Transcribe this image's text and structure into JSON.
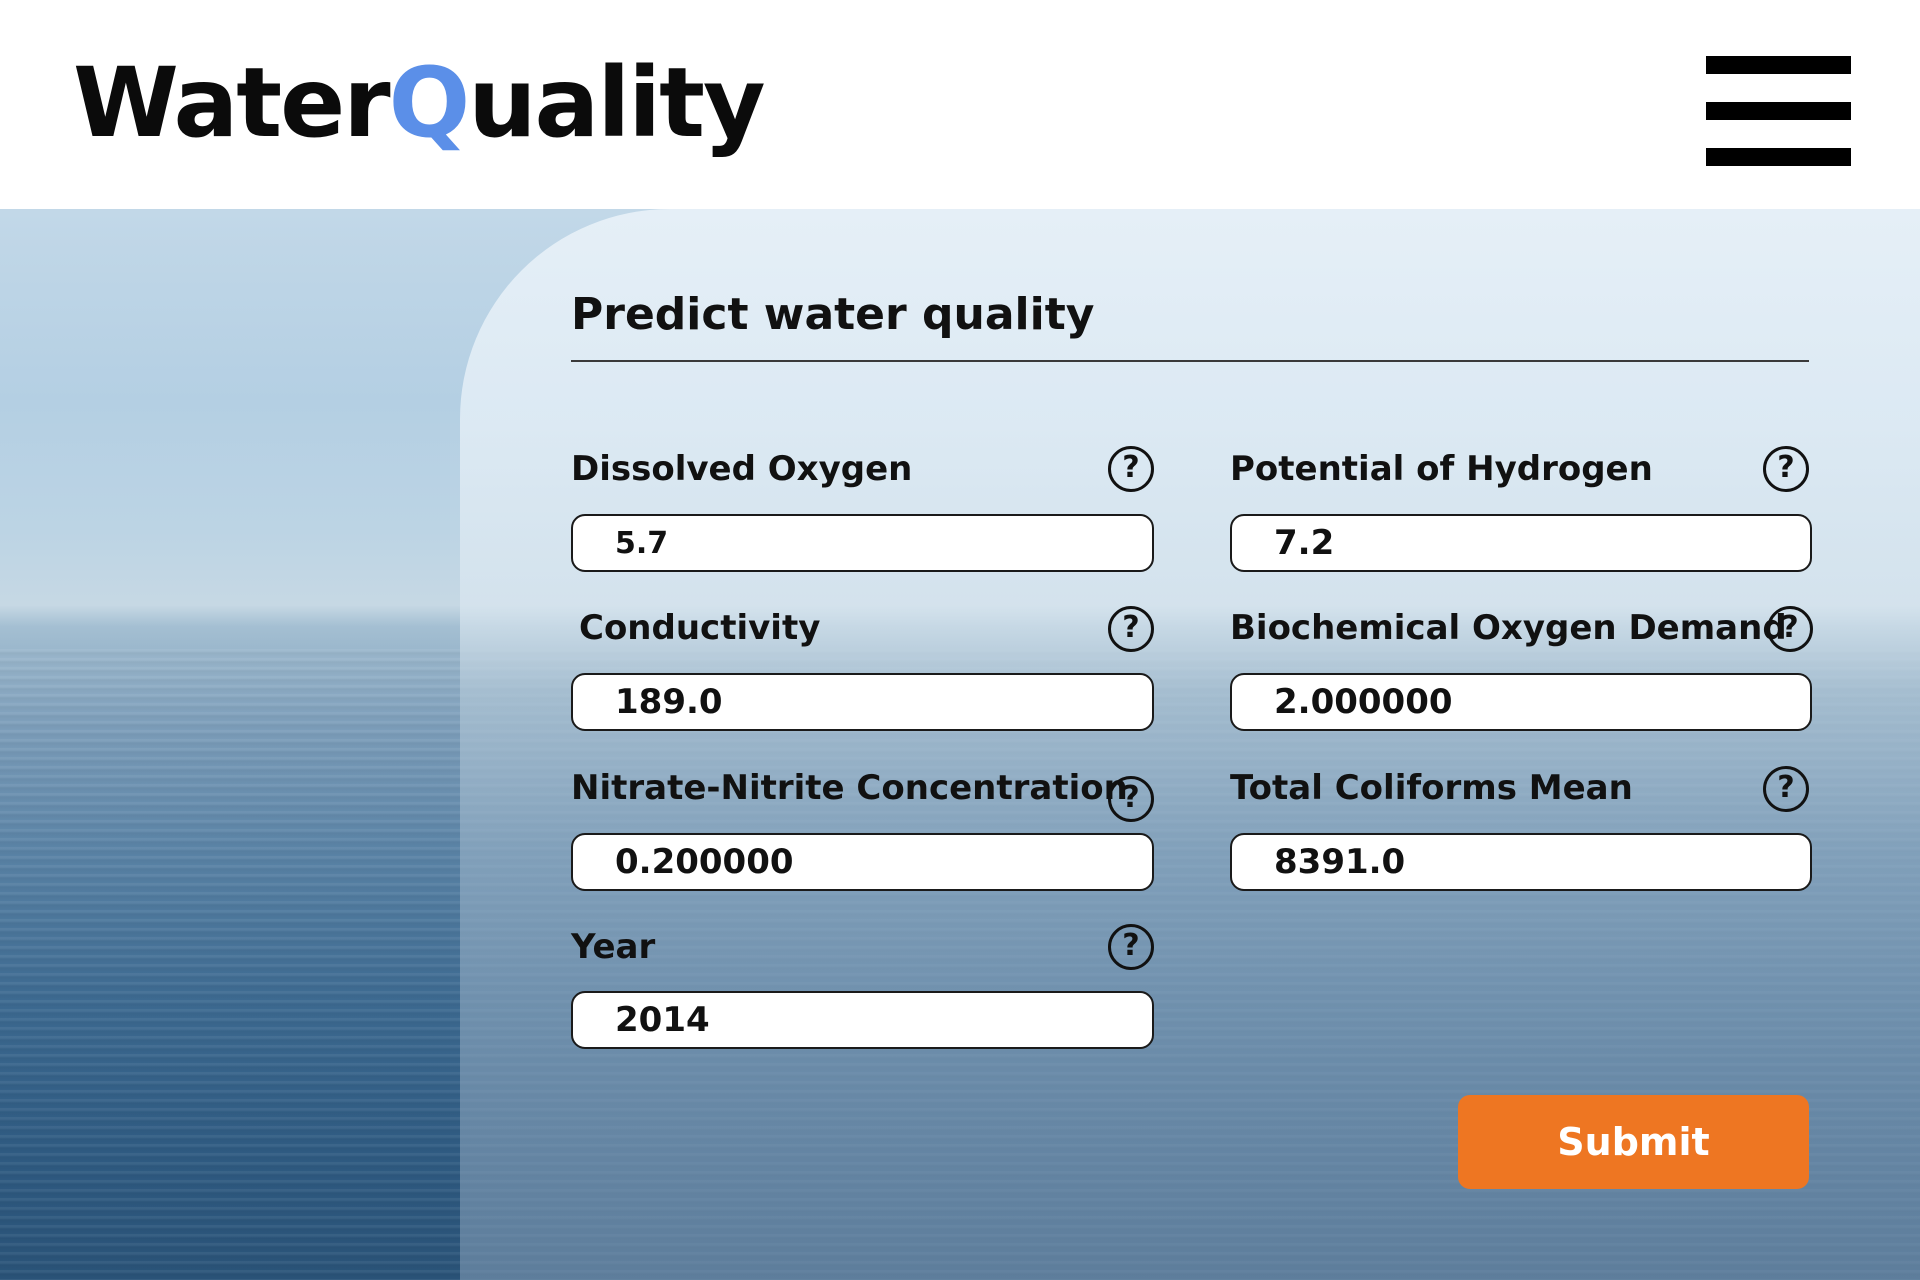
{
  "header": {
    "logo_part1": "Water",
    "logo_part2": "Q",
    "logo_part3": "uality",
    "menu_icon": "hamburger-menu-icon"
  },
  "form": {
    "title": "Predict water quality",
    "fields": {
      "dissolved_oxygen": {
        "label": "Dissolved Oxygen",
        "value": "5.7"
      },
      "ph": {
        "label": "Potential of Hydrogen",
        "value": "7.2"
      },
      "conductivity": {
        "label": "Conductivity",
        "value": "189.0"
      },
      "bod": {
        "label": "Biochemical Oxygen Demand",
        "value": "2.000000"
      },
      "nitrate": {
        "label": "Nitrate-Nitrite Concentration",
        "value": "0.200000"
      },
      "coliforms": {
        "label": "Total Coliforms Mean",
        "value": "8391.0"
      },
      "year": {
        "label": "Year",
        "value": "2014"
      }
    },
    "help_glyph": "?",
    "help_icon": "question-circle-icon",
    "submit_label": "Submit"
  },
  "colors": {
    "accent_blue": "#5b8fe8",
    "submit_orange": "#ee7622"
  }
}
